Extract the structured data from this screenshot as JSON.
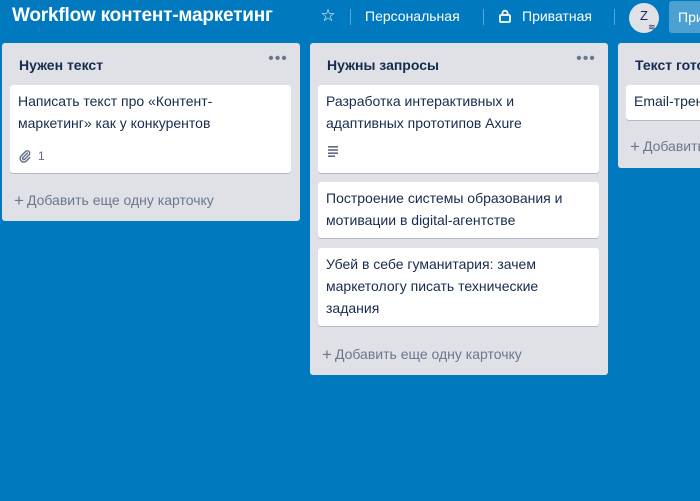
{
  "header": {
    "board_title": "Workflow контент-маркетинг",
    "team_label": "Персональная",
    "visibility_label": "Приватная",
    "avatar_initial": "Z",
    "invite_label": "Пригласить"
  },
  "lists": [
    {
      "title": "Нужен текст",
      "cards": [
        {
          "text": "Написать текст про «Контент-маркетинг» как у конкурентов",
          "attachments": "1"
        }
      ],
      "add_label": "Добавить еще одну карточку"
    },
    {
      "title": "Нужны запросы",
      "cards": [
        {
          "text": "Разработка интерактивных и адаптивных прототипов Axure",
          "has_description": true
        },
        {
          "text": "Построение системы образования и мотивации в digital-агентстве"
        },
        {
          "text": "Убей в себе гуманитария: зачем маркетологу писать технические задания"
        }
      ],
      "add_label": "Добавить еще одну карточку"
    },
    {
      "title": "Текст готов",
      "cards": [
        {
          "text": "Email-тренды"
        }
      ],
      "add_label": "Добавить еще одну карточку"
    }
  ],
  "colors": {
    "board_background": "#0079bf",
    "list_background": "#dfe1e6",
    "card_background": "#ffffff"
  }
}
